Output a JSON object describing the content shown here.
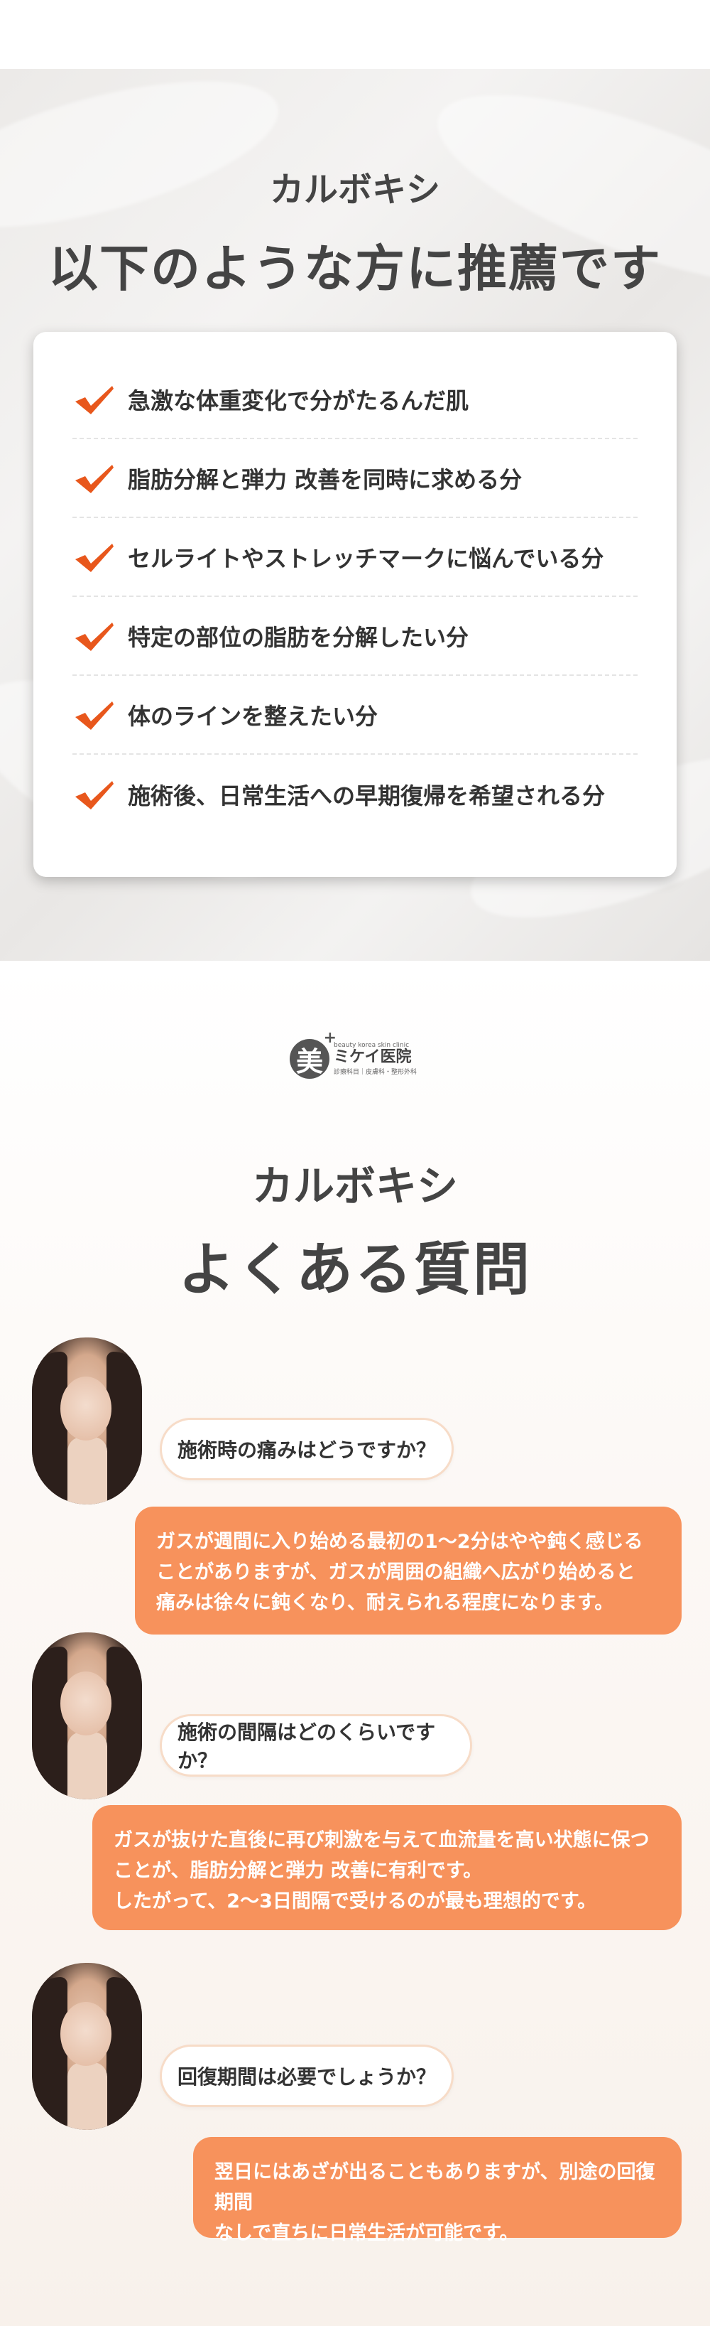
{
  "section1": {
    "subtitle": "カルボキシ",
    "title": "以下のような方に推薦です",
    "items": [
      "急激な体重変化で分がたるんだ肌",
      "脂肪分解と弾力 改善を同時に求める分",
      "セルライトやストレッチマークに悩んでいる分",
      "特定の部位の脂肪を分解したい分",
      "体のラインを整えたい分",
      "施術後、日常生活への早期復帰を希望される分"
    ],
    "accent_color": "#e8571c"
  },
  "logo": {
    "mark": "美",
    "plus": "+",
    "en": "beauty korea skin clinic",
    "name": "ミケイ医院",
    "sub": "診療科目｜皮膚科・整形外科"
  },
  "section2": {
    "subtitle": "カルボキシ",
    "title": "よくある質問",
    "faq": [
      {
        "question": "施術時の痛みはどうですか？",
        "answer_lines": [
          "ガスが週間に入り始める最初の1〜2分はやや鈍く感じる",
          "ことがありますが、ガスが周囲の組織へ広がり始めると",
          "痛みは徐々に鈍くなり、耐えられる程度になります。"
        ]
      },
      {
        "question": "施術の間隔はどのくらいですか？",
        "answer_lines": [
          "ガスが抜けた直後に再び刺激を与えて血流量を高い状態に保つ",
          "ことが、脂肪分解と弾力 改善に有利です。",
          "したがって、2〜3日間隔で受けるのが最も理想的です。"
        ]
      },
      {
        "question": "回復期間は必要でしょうか？",
        "answer_lines": [
          "翌日にはあざが出ることもありますが、別途の回復期間",
          "なしで直ちに日常生活が可能です。"
        ]
      }
    ],
    "answer_color": "#f7925c"
  }
}
